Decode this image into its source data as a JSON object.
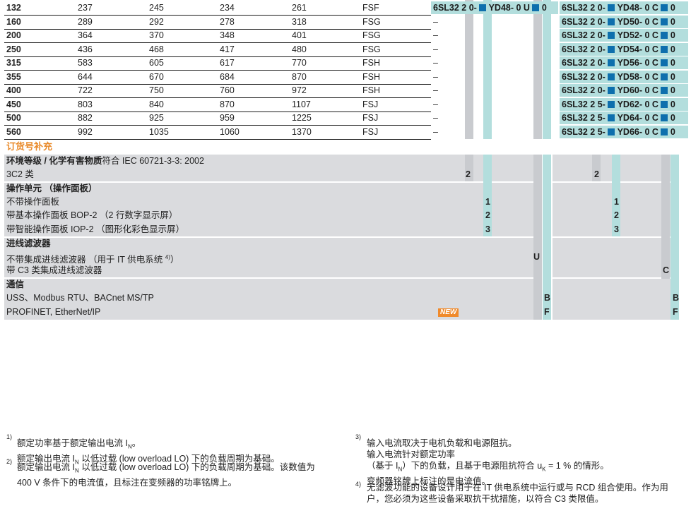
{
  "table_rows": [
    {
      "size": "132",
      "v1": "237",
      "v2": "245",
      "v3": "234",
      "v4": "261",
      "frame": "FSF",
      "dash": "",
      "code_left": "6SL32 2 0-",
      "code_mid": "YD48- 0 U",
      "code_right_prefix": "6SL32 2 0-",
      "code_right_mid": "YD48- 0 C",
      "tail": "0"
    },
    {
      "size": "160",
      "v1": "289",
      "v2": "292",
      "v3": "278",
      "v4": "318",
      "frame": "FSG",
      "dash": "–",
      "code_right_prefix": "6SL32 2 0-",
      "code_right_mid": "YD50- 0 C",
      "tail": "0"
    },
    {
      "size": "200",
      "v1": "364",
      "v2": "370",
      "v3": "348",
      "v4": "401",
      "frame": "FSG",
      "dash": "–",
      "code_right_prefix": "6SL32 2 0-",
      "code_right_mid": "YD52- 0 C",
      "tail": "0"
    },
    {
      "size": "250",
      "v1": "436",
      "v2": "468",
      "v3": "417",
      "v4": "480",
      "frame": "FSG",
      "dash": "–",
      "code_right_prefix": "6SL32 2 0-",
      "code_right_mid": "YD54- 0 C",
      "tail": "0"
    },
    {
      "size": "315",
      "v1": "583",
      "v2": "605",
      "v3": "617",
      "v4": "770",
      "frame": "FSH",
      "dash": "–",
      "code_right_prefix": "6SL32 2 0-",
      "code_right_mid": "YD56- 0 C",
      "tail": "0"
    },
    {
      "size": "355",
      "v1": "644",
      "v2": "670",
      "v3": "684",
      "v4": "870",
      "frame": "FSH",
      "dash": "–",
      "code_right_prefix": "6SL32 2 0-",
      "code_right_mid": "YD58- 0 C",
      "tail": "0"
    },
    {
      "size": "400",
      "v1": "722",
      "v2": "750",
      "v3": "760",
      "v4": "972",
      "frame": "FSH",
      "dash": "–",
      "code_right_prefix": "6SL32 2 0-",
      "code_right_mid": "YD60- 0 C",
      "tail": "0"
    },
    {
      "size": "450",
      "v1": "803",
      "v2": "840",
      "v3": "870",
      "v4": "1107",
      "frame": "FSJ",
      "dash": "–",
      "code_right_prefix": "6SL32 2 5-",
      "code_right_mid": "YD62- 0 C",
      "tail": "0"
    },
    {
      "size": "500",
      "v1": "882",
      "v2": "925",
      "v3": "959",
      "v4": "1225",
      "frame": "FSJ",
      "dash": "–",
      "code_right_prefix": "6SL32 2 5-",
      "code_right_mid": "YD64- 0 C",
      "tail": "0"
    },
    {
      "size": "560",
      "v1": "992",
      "v2": "1035",
      "v3": "1060",
      "v4": "1370",
      "frame": "FSJ",
      "dash": "–",
      "code_right_prefix": "6SL32 2 5-",
      "code_right_mid": "YD66- 0 C",
      "tail": "0"
    }
  ],
  "supplement_title": "订货号补充",
  "options": {
    "env_title": "环境等级 / 化学有害物质",
    "env_title_suffix": "符合 IEC 60721-3-3: 2002",
    "env_3c2": "3C2 类",
    "env_3c2_code": "2",
    "op_title": "操作单元 （操作面板）",
    "op_none": "不带操作面板",
    "op_none_code": "1",
    "op_bop": "带基本操作面板 BOP-2 （2 行数字显示屏）",
    "op_bop_code": "2",
    "op_iop": "带智能操作面板 IOP-2 （图形化彩色显示屏）",
    "op_iop_code": "3",
    "filter_title": "进线滤波器",
    "filter_none": "不带集成进线滤波器 （用于 IT 供电系统 ",
    "filter_none_sup": "4)",
    "filter_none_tail": "）",
    "filter_none_code": "U",
    "filter_c3": "带 C3 类集成进线滤波器",
    "filter_c3_code": "C",
    "comm_title": "通信",
    "comm_uss": "USS、Modbus RTU、BACnet MS/TP",
    "comm_uss_code": "B",
    "comm_pn": "PROFINET, EtherNet/IP",
    "comm_pn_code": "F",
    "new_badge": "NEW"
  },
  "footnotes": {
    "f1_num": "1)",
    "f1_line1": "额定功率基于额定输出电流 I",
    "f1_line1_sub": "N",
    "f1_line1_end": "。",
    "f1_line2a": "额定输出电流 I",
    "f1_line2_sub": "N",
    "f1_line2b": " 以低过载 (low overload LO) 下的负载周期为基础。",
    "f2_num": "2)",
    "f2_line1a": "额定输出电流 I",
    "f2_line1_sub": "N",
    "f2_line1b": " 以低过载 (low overload LO) 下的负载周期为基础。该数值为",
    "f2_line2": "400 V 条件下的电流值，且标注在变频器的功率铭牌上。",
    "f3_num": "3)",
    "f3_line1": "输入电流取决于电机负载和电源阻抗。",
    "f3_line2": "输入电流针对额定功率",
    "f3_line3a": "（基于 I",
    "f3_line3_sub": "N",
    "f3_line3b": "）下的负载，且基于电源阻抗符合 u",
    "f3_line3_sub2": "K",
    "f3_line3c": " = 1 % 的情形。",
    "f3_line4": "变频器铭牌上标注的是电流值。",
    "f4_num": "4)",
    "f4_line1": "无滤波功能的设备设计用于在 IT 供电系统中运行或与 RCD 组合使用。作为用",
    "f4_line2": "户，您必须为这些设备采取抗干扰措施，以符合 C3 类限值。"
  },
  "colors": {
    "accent_orange": "#e98a2a",
    "teal": "#b3dedd",
    "grey": "#c9cbcf",
    "square_blue": "#0e6fad"
  }
}
